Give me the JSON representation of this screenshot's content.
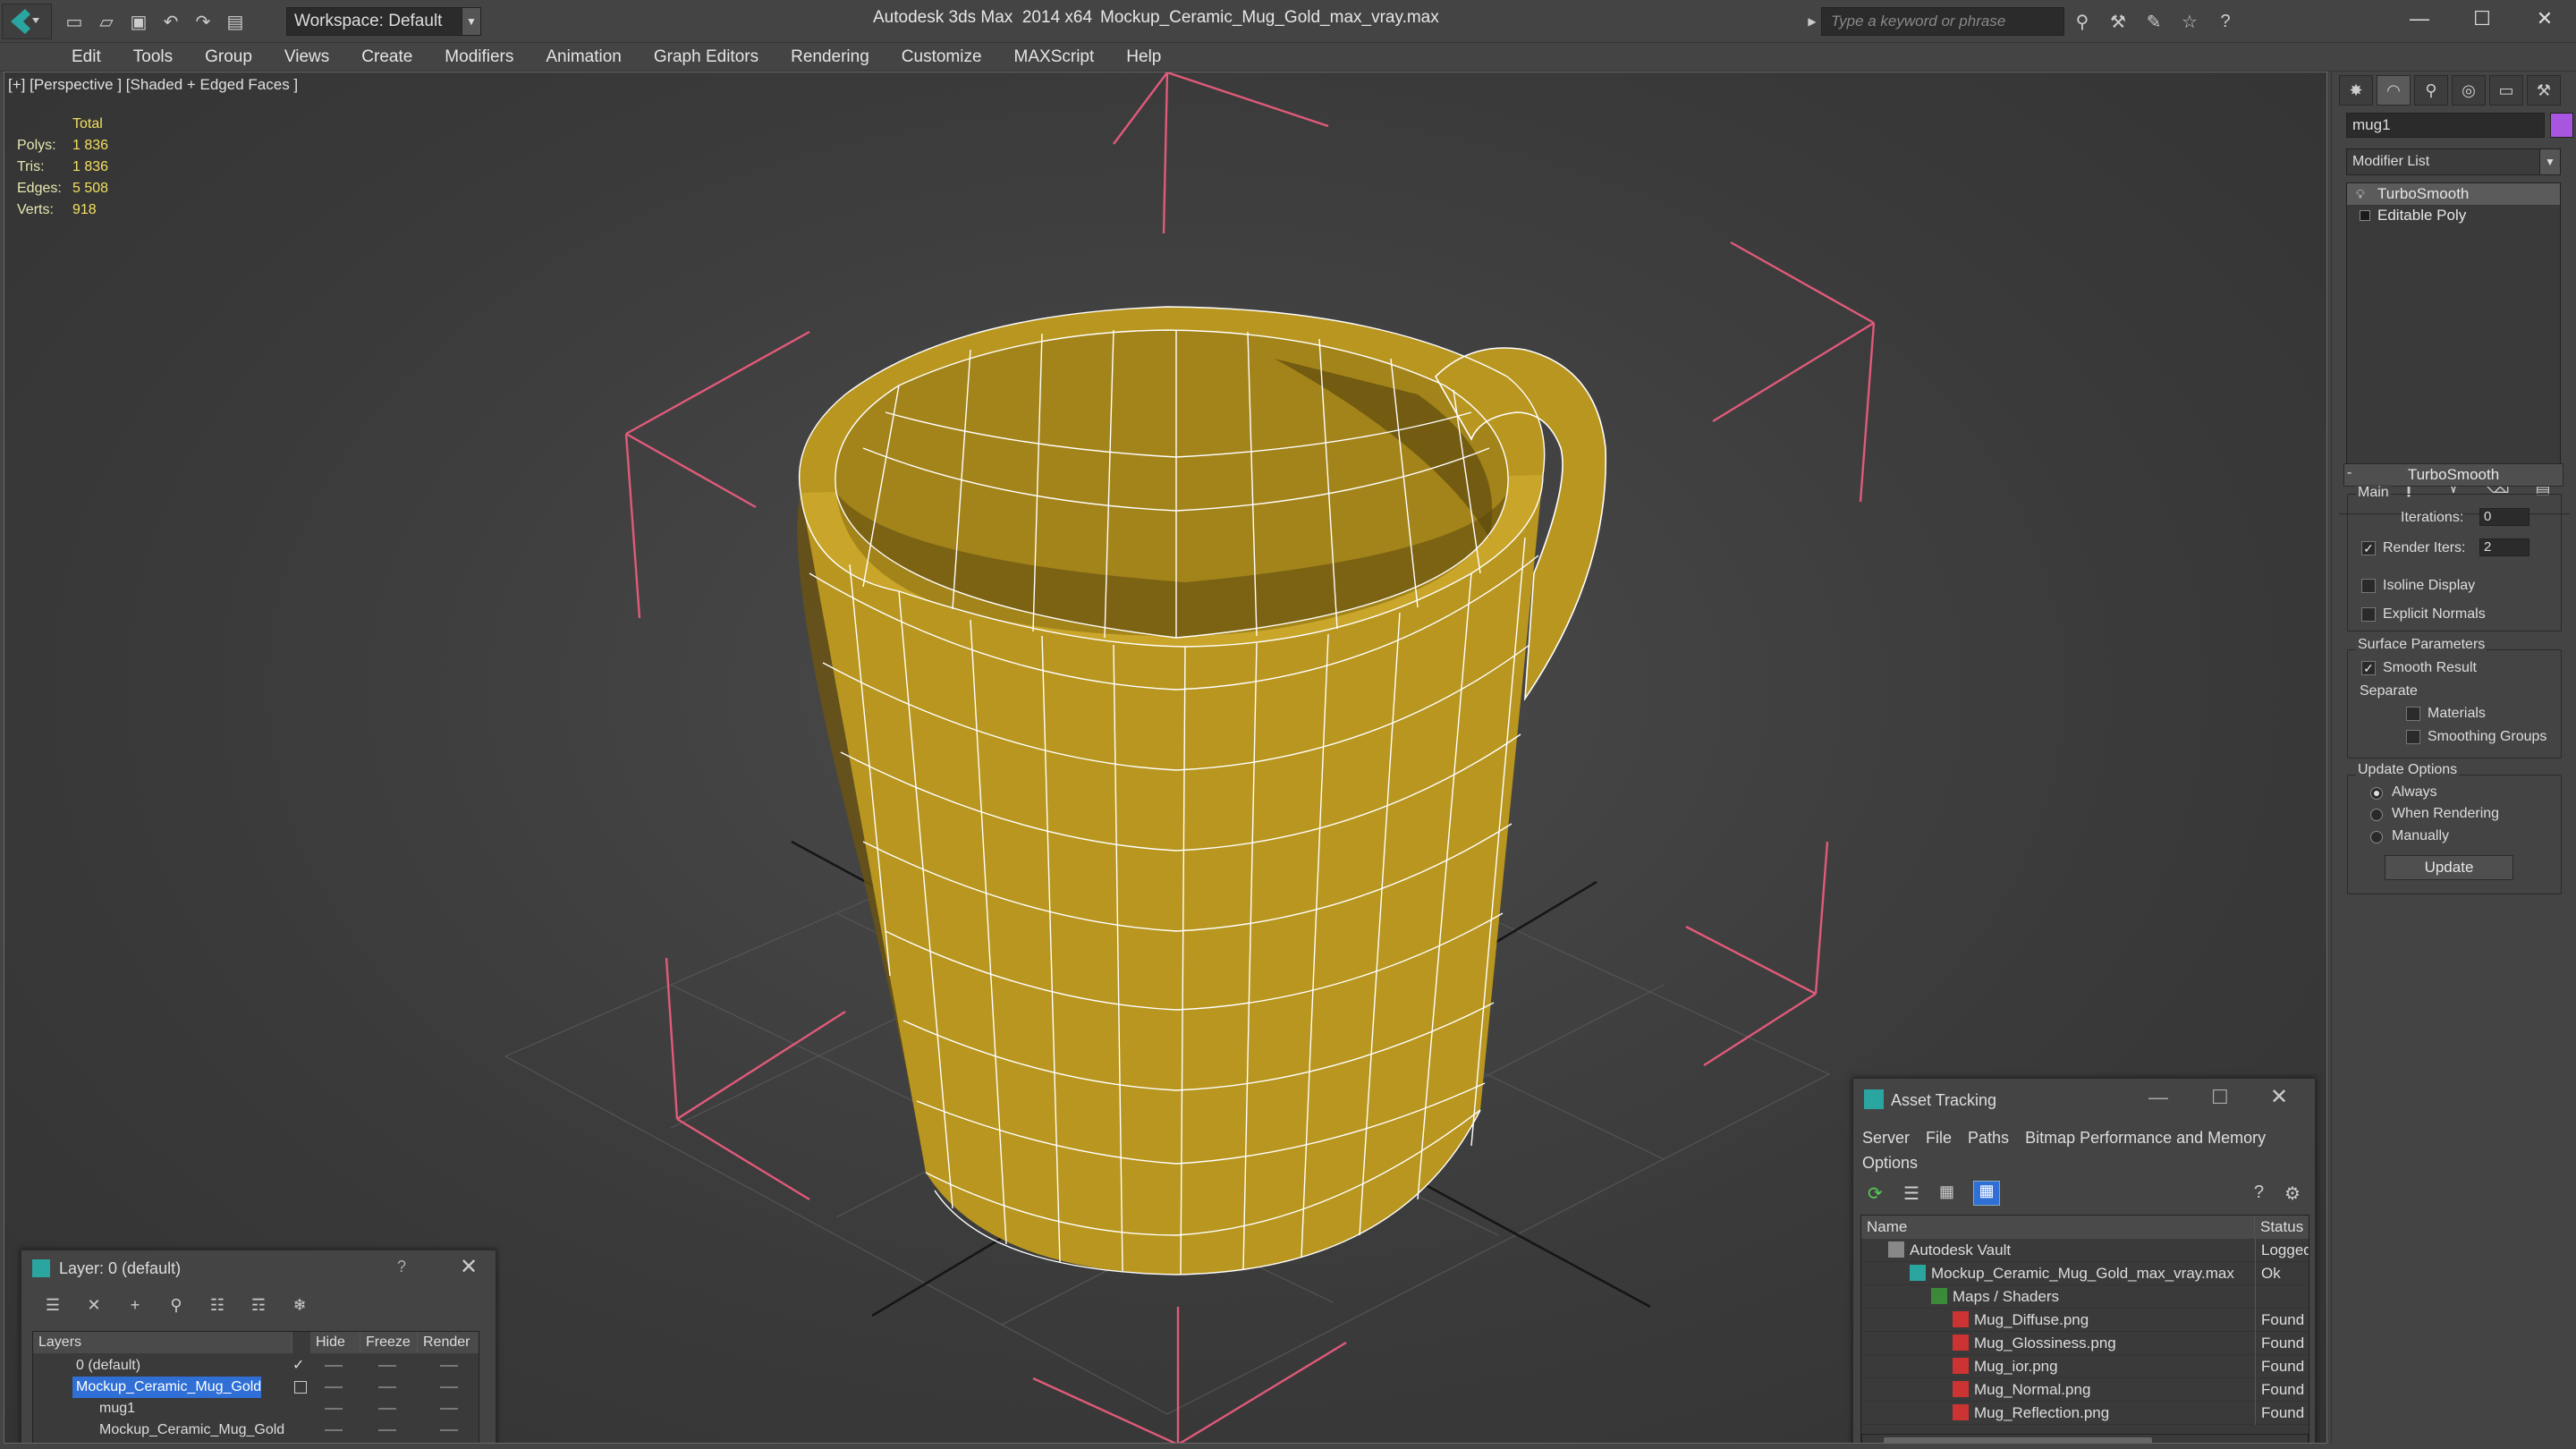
{
  "titlebar": {
    "workspace": "Workspace: Default",
    "app_title": "Autodesk 3ds Max  2014 x64",
    "file_title": "Mockup_Ceramic_Mug_Gold_max_vray.max",
    "search_placeholder": "Type a keyword or phrase"
  },
  "menu": [
    "Edit",
    "Tools",
    "Group",
    "Views",
    "Create",
    "Modifiers",
    "Animation",
    "Graph Editors",
    "Rendering",
    "Customize",
    "MAXScript",
    "Help"
  ],
  "viewport": {
    "label": "[+] [Perspective ] [Shaded + Edged Faces ]",
    "stats": {
      "header": "Total",
      "polys_label": "Polys:",
      "polys": "1 836",
      "tris_label": "Tris:",
      "tris": "1 836",
      "edges_label": "Edges:",
      "edges": "5 508",
      "verts_label": "Verts:",
      "verts": "918"
    },
    "mug_color": "#b8961f",
    "wire_color": "#ffffff",
    "gizmo_color": "#e05a7a"
  },
  "command_panel": {
    "object_name": "mug1",
    "object_color": "#a855e0",
    "modifier_list": "Modifier List",
    "stack": [
      "TurboSmooth",
      "Editable Poly"
    ],
    "turbosmooth": {
      "title": "TurboSmooth",
      "main_group": "Main",
      "iterations_label": "Iterations:",
      "iterations": "0",
      "render_iters_label": "Render Iters:",
      "render_iters": "2",
      "isoline": "Isoline Display",
      "explicit_normals": "Explicit Normals",
      "surface_group": "Surface Parameters",
      "smooth_result": "Smooth Result",
      "separate": "Separate",
      "materials": "Materials",
      "smoothing_groups": "Smoothing Groups",
      "update_group": "Update Options",
      "always": "Always",
      "when_rendering": "When Rendering",
      "manually": "Manually",
      "update_btn": "Update"
    }
  },
  "layer_window": {
    "title": "Layer: 0 (default)",
    "help": "?",
    "columns": [
      "Layers",
      "Hide",
      "Freeze",
      "Render"
    ],
    "rows": [
      "0 (default)",
      "Mockup_Ceramic_Mug_Gold",
      "mug1",
      "Mockup_Ceramic_Mug_Gold"
    ]
  },
  "asset_window": {
    "title": "Asset Tracking",
    "menu": [
      "Server",
      "File",
      "Paths",
      "Bitmap Performance and Memory"
    ],
    "menu2": "Options",
    "columns": [
      "Name",
      "Status"
    ],
    "rows": [
      {
        "name": "Autodesk Vault",
        "status": "Logged"
      },
      {
        "name": "Mockup_Ceramic_Mug_Gold_max_vray.max",
        "status": "Ok"
      },
      {
        "name": "Maps / Shaders",
        "status": ""
      },
      {
        "name": "Mug_Diffuse.png",
        "status": "Found"
      },
      {
        "name": "Mug_Glossiness.png",
        "status": "Found"
      },
      {
        "name": "Mug_ior.png",
        "status": "Found"
      },
      {
        "name": "Mug_Normal.png",
        "status": "Found"
      },
      {
        "name": "Mug_Reflection.png",
        "status": "Found"
      }
    ]
  }
}
